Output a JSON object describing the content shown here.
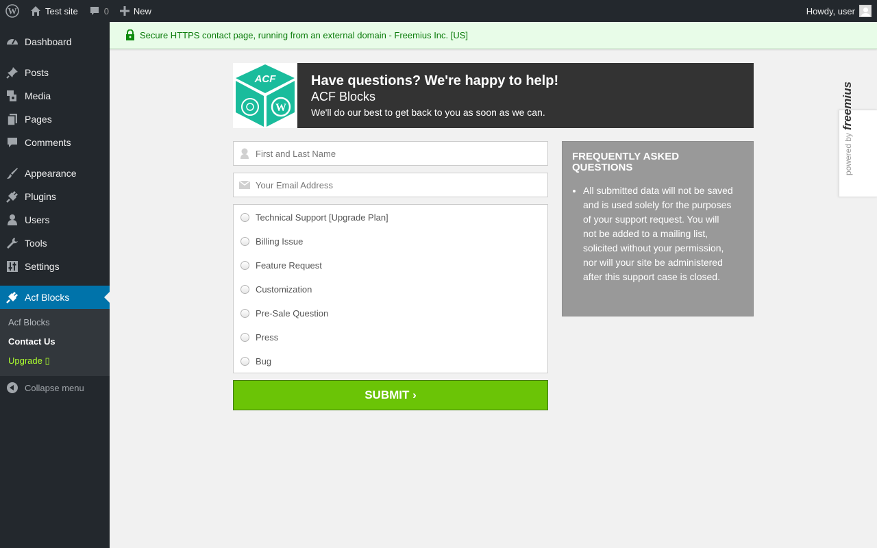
{
  "adminbar": {
    "site_name": "Test site",
    "comments_count": "0",
    "new_label": "New",
    "greeting": "Howdy, user"
  },
  "sidebar": {
    "items": [
      {
        "label": "Dashboard",
        "icon": "dashboard-icon"
      },
      {
        "label": "Posts",
        "icon": "pin-icon"
      },
      {
        "label": "Media",
        "icon": "media-icon"
      },
      {
        "label": "Pages",
        "icon": "pages-icon"
      },
      {
        "label": "Comments",
        "icon": "comment-icon"
      },
      {
        "label": "Appearance",
        "icon": "brush-icon"
      },
      {
        "label": "Plugins",
        "icon": "plug-icon"
      },
      {
        "label": "Users",
        "icon": "user-icon"
      },
      {
        "label": "Tools",
        "icon": "wrench-icon"
      },
      {
        "label": "Settings",
        "icon": "sliders-icon"
      },
      {
        "label": "Acf Blocks",
        "icon": "plug-icon",
        "active": true
      }
    ],
    "submenu": [
      {
        "label": "Acf Blocks"
      },
      {
        "label": "Contact Us",
        "current": true
      },
      {
        "label": "Upgrade ",
        "highlight": true
      }
    ],
    "collapse_label": "Collapse menu"
  },
  "notice": {
    "text": "Secure HTTPS contact page, running from an external domain - Freemius Inc. [US]"
  },
  "header": {
    "logo_text": "ACF",
    "title": "Have questions? We're happy to help!",
    "subtitle": "ACF Blocks",
    "note": "We'll do our best to get back to you as soon as we can."
  },
  "form": {
    "name_placeholder": "First and Last Name",
    "email_placeholder": "Your Email Address",
    "options": [
      "Technical Support [Upgrade Plan]",
      "Billing Issue",
      "Feature Request",
      "Customization",
      "Pre-Sale Question",
      "Press",
      "Bug"
    ],
    "submit_label": "SUBMIT ›"
  },
  "faq": {
    "title": "FREQUENTLY ASKED QUESTIONS",
    "items": [
      "All submitted data will not be saved and is used solely for the purposes of your support request. You will not be added to a mailing list, solicited without your permission, nor will your site be administered after this support case is closed."
    ]
  },
  "powered": {
    "by": "powered by",
    "brand": "freemius"
  },
  "colors": {
    "accent": "#0073aa",
    "submit": "#6bc406",
    "notice_text": "#097b09",
    "logo_teal": "#1abc9c"
  }
}
